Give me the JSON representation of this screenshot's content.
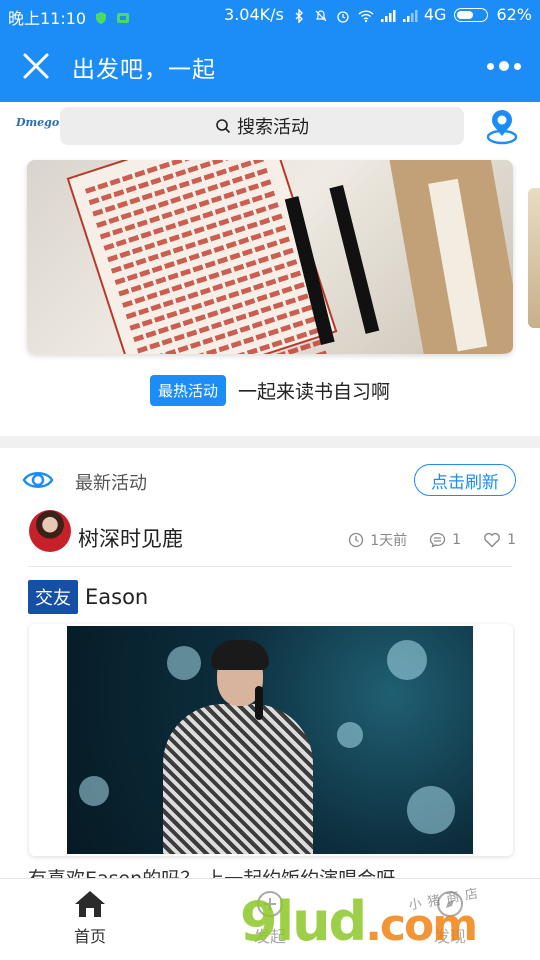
{
  "status_bar": {
    "time": "晚上11:10",
    "network_speed": "3.04K/s",
    "network_type": "4G",
    "battery": "62%",
    "battery_level": 0.62
  },
  "header": {
    "title": "出发吧，一起",
    "close_icon": "close-icon",
    "more_icon": "more-dots-icon"
  },
  "search": {
    "logo": "Dmego",
    "placeholder": "搜索活动"
  },
  "featured": {
    "badge": "最热活动",
    "title": "一起来读书自习啊"
  },
  "latest": {
    "label": "最新活动",
    "refresh": "点击刷新"
  },
  "post": {
    "author": "树深时见鹿",
    "time_ago": "1天前",
    "comments": "1",
    "likes": "1",
    "tag": "交友",
    "title": "Eason",
    "description": "有喜欢Eason的吗？ 上一起约饭约演唱会呀"
  },
  "bottom_nav": [
    {
      "label": "首页",
      "icon": "home-icon"
    },
    {
      "label": "发起",
      "icon": "add-icon"
    },
    {
      "label": "发现",
      "icon": "discover-icon"
    }
  ],
  "watermark": {
    "main": "9lud",
    "tail": ".com",
    "small": "小猪商店"
  },
  "colors": {
    "primary": "#1c8cf6",
    "tag": "#1550a6"
  }
}
